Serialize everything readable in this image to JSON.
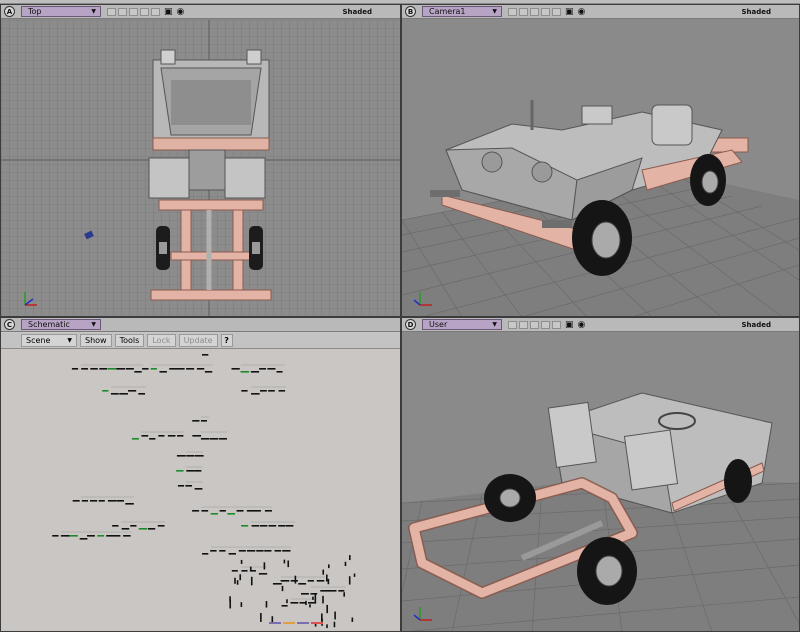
{
  "viewports": {
    "a": {
      "letter": "A",
      "view": "Top",
      "mode": "Shaded"
    },
    "b": {
      "letter": "B",
      "view": "Camera1",
      "mode": "Shaded"
    },
    "c": {
      "letter": "C",
      "view": "Schematic"
    },
    "d": {
      "letter": "D",
      "view": "User",
      "mode": "Shaded"
    }
  },
  "schematic": {
    "scene_label": "Scene",
    "show_label": "Show",
    "tools_label": "Tools",
    "lock_label": "Lock",
    "update_label": "Update",
    "help_label": "?"
  },
  "icons": [
    "viewport-menu-arrow-icon",
    "camera-icon",
    "eye-icon",
    "axis-tripod-icon",
    "help-icon"
  ],
  "colors": {
    "viewport_bg": "#8a8a8a",
    "grid": "#6f6f6f",
    "chassis": "#e3b4a6",
    "tab": "#b7a4c5",
    "schematic_bg": "#c9c6c3"
  }
}
